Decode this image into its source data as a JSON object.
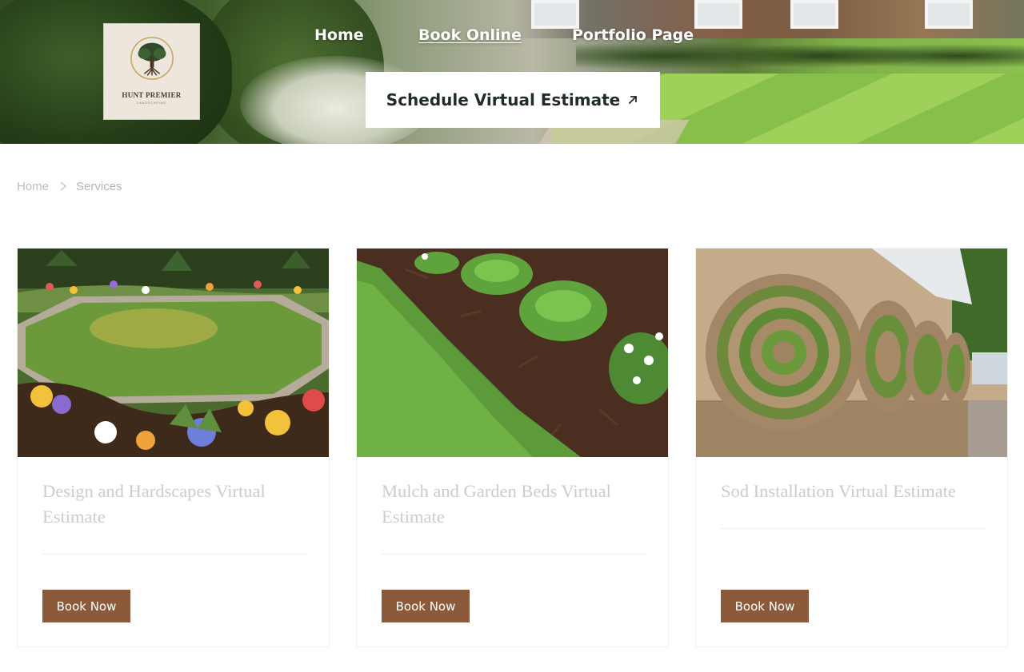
{
  "brand": {
    "logo_name": "HUNT PREMIER",
    "logo_subtitle": "LANDSCAPING"
  },
  "nav": {
    "items": [
      {
        "label": "Home",
        "active": false
      },
      {
        "label": "Book Online",
        "active": true
      },
      {
        "label": "Portfolio Page",
        "active": false
      }
    ]
  },
  "cta": {
    "label": "Schedule Virtual Estimate",
    "icon": "arrow-up-right-icon"
  },
  "breadcrumb": {
    "home": "Home",
    "separator_icon": "chevron-right-icon",
    "current": "Services"
  },
  "services": [
    {
      "title": "Design and Hardscapes Virtual Estimate",
      "button": "Book Now",
      "image": "hexagonal-lawn-with-flower-beds"
    },
    {
      "title": "Mulch and Garden Beds Virtual Estimate",
      "button": "Book Now",
      "image": "grass-edge-with-mulch-and-ferns"
    },
    {
      "title": "Sod Installation Virtual Estimate",
      "button": "Book Now",
      "image": "stacked-sod-rolls"
    }
  ],
  "colors": {
    "button_bg": "#8a5a3b",
    "title_text": "#c9cecb",
    "breadcrumb_text": "#bdbdbd"
  }
}
